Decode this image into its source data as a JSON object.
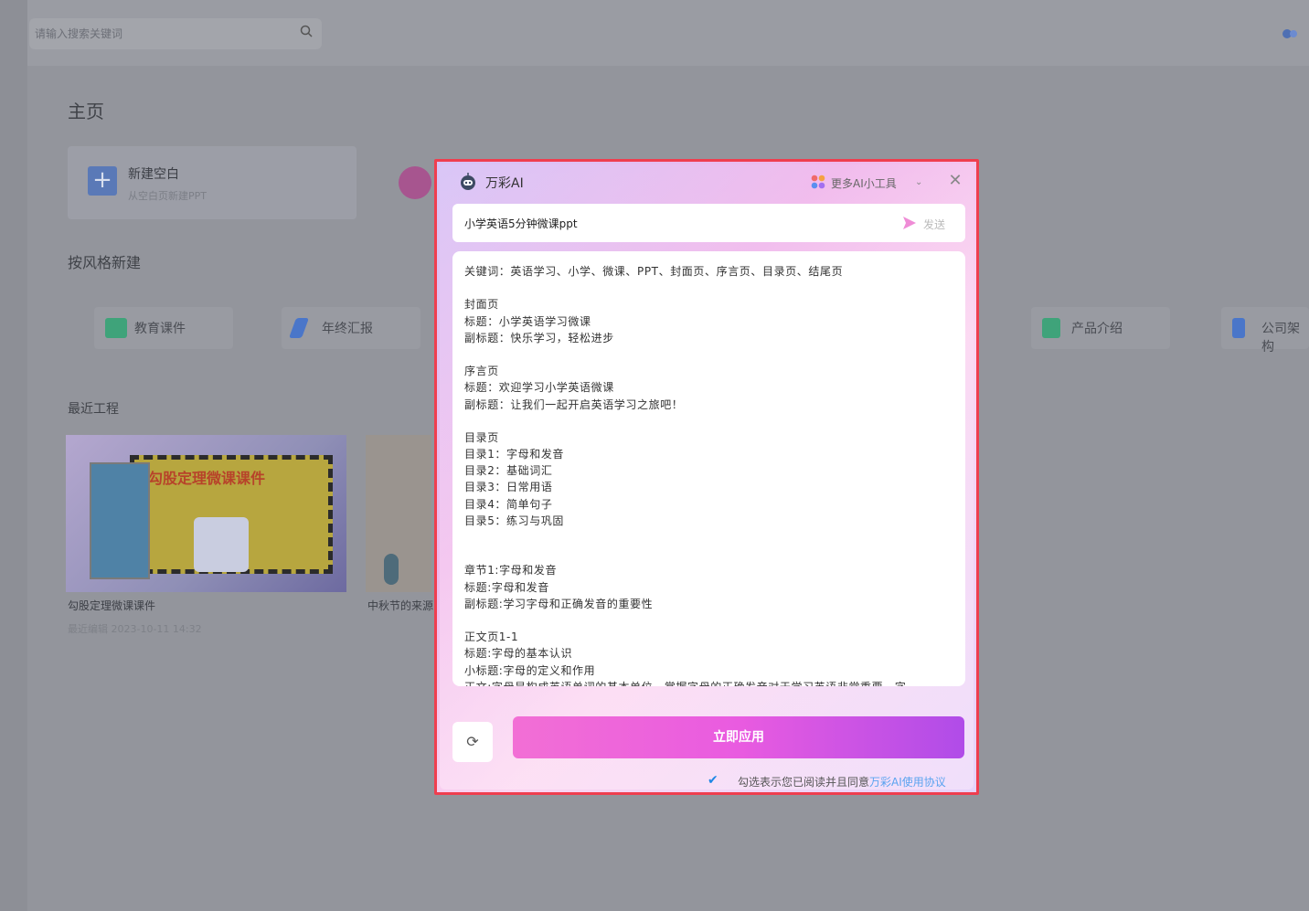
{
  "search": {
    "placeholder": "请输入搜索关键词"
  },
  "home": {
    "title": "主页"
  },
  "new_card": {
    "title": "新建空白",
    "subtitle": "从空白页新建PPT"
  },
  "style_section": {
    "title": "按风格新建",
    "items": [
      {
        "label": "教育课件",
        "icon": "education-icon",
        "color": "#3fa37a"
      },
      {
        "label": "年终汇报",
        "icon": "pen-icon",
        "color": "#4a76c9"
      },
      {
        "label": "产品介绍",
        "icon": "product-icon",
        "color": "#3fa37a"
      },
      {
        "label": "公司架构",
        "icon": "building-icon",
        "color": "#4a76c9"
      }
    ]
  },
  "recent_section": {
    "title": "最近工程",
    "projects": [
      {
        "name": "勾股定理微课课件",
        "subtitle": "最近编辑 2023-10-11 14:32"
      },
      {
        "name": "中秋节的来源"
      }
    ]
  },
  "thumb": {
    "title": "勾股定理微课课件"
  },
  "modal": {
    "title": "万彩AI",
    "more_tools": "更多AI小工具",
    "input_value": "小学英语5分钟微课ppt",
    "send_label": "发送",
    "content_lines": [
      "关键词：英语学习、小学、微课、PPT、封面页、序言页、目录页、结尾页",
      "",
      "封面页",
      "标题：小学英语学习微课",
      "副标题：快乐学习，轻松进步",
      "",
      "序言页",
      "标题：欢迎学习小学英语微课",
      "副标题：让我们一起开启英语学习之旅吧！",
      "",
      "目录页",
      "目录1：字母和发音",
      "目录2：基础词汇",
      "目录3：日常用语",
      "目录4：简单句子",
      "目录5：练习与巩固",
      "",
      "",
      "章节1:字母和发音",
      "标题:字母和发音",
      "副标题:学习字母和正确发音的重要性",
      "",
      "正文页1-1",
      "标题:字母的基本认识",
      "小标题:字母的定义和作用",
      "正文:字母是构成英语单词的基本单位，掌握字母的正确发音对于学习英语非常重要。字"
    ],
    "apply_label": "立即应用",
    "agree_text": "勾选表示您已阅读并且同意",
    "agree_link": "万彩AI使用协议"
  }
}
